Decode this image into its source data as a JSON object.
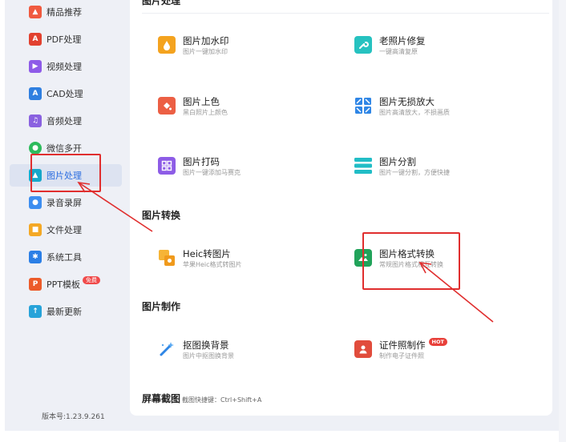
{
  "sidebar": {
    "items": [
      {
        "label": "精品推荐",
        "icon": "thumbs-up-icon",
        "color": "#f05a3f",
        "glyph": "👍"
      },
      {
        "label": "PDF处理",
        "icon": "pdf-icon",
        "color": "#e2412f",
        "glyph": "A"
      },
      {
        "label": "视频处理",
        "icon": "video-play-icon",
        "color": "#8e5be8",
        "glyph": "▶"
      },
      {
        "label": "CAD处理",
        "icon": "cad-icon",
        "color": "#2f7fe0",
        "glyph": "A"
      },
      {
        "label": "音频处理",
        "icon": "music-note-icon",
        "color": "#8a62e0",
        "glyph": "♫"
      },
      {
        "label": "微信多开",
        "icon": "wechat-icon",
        "color": "#2dbb5c",
        "glyph": "◉"
      },
      {
        "label": "图片处理",
        "icon": "image-icon",
        "color": "#18a7c9",
        "glyph": "▲"
      },
      {
        "label": "录音录屏",
        "icon": "microphone-icon",
        "color": "#3d8ef0",
        "glyph": "●"
      },
      {
        "label": "文件处理",
        "icon": "folder-icon",
        "color": "#f4a825",
        "glyph": "■"
      },
      {
        "label": "系统工具",
        "icon": "gear-icon",
        "color": "#2b7fe6",
        "glyph": "✱"
      },
      {
        "label": "PPT模板",
        "icon": "ppt-icon",
        "color": "#ec5b2a",
        "glyph": "P",
        "badge": "免费"
      },
      {
        "label": "最新更新",
        "icon": "upload-icon",
        "color": "#27a3d9",
        "glyph": "↑"
      }
    ],
    "version": "版本号:1.23.9.261"
  },
  "sections": {
    "image_processing": "图片处理",
    "image_convert": "图片转换",
    "image_make": "图片制作",
    "screenshot": "屏幕截图",
    "screenshot_hint": "截图快捷键：Ctrl+Shift+A"
  },
  "tools": {
    "watermark": {
      "title": "图片加水印",
      "desc": "图片一键加水印"
    },
    "restore": {
      "title": "老照片修复",
      "desc": "一键高清复原"
    },
    "colorize": {
      "title": "图片上色",
      "desc": "黑白照片上颜色"
    },
    "enlarge": {
      "title": "图片无损放大",
      "desc": "图片高清放大，不损画质"
    },
    "mosaic": {
      "title": "图片打码",
      "desc": "图片一键添加马赛克"
    },
    "split": {
      "title": "图片分割",
      "desc": "图片一键分割，方便快捷"
    },
    "heic": {
      "title": "Heic转图片",
      "desc": "苹果Heic格式转图片"
    },
    "format": {
      "title": "图片格式转换",
      "desc": "常规图片格式相互转换"
    },
    "cutout": {
      "title": "抠图换背景",
      "desc": "图片中抠图换背景"
    },
    "idphoto": {
      "title": "证件照制作",
      "desc": "制作电子证件照",
      "badge": "HOT"
    }
  },
  "colors": {
    "accent": "#2b6de0",
    "highlight_box": "#e02e2e"
  }
}
